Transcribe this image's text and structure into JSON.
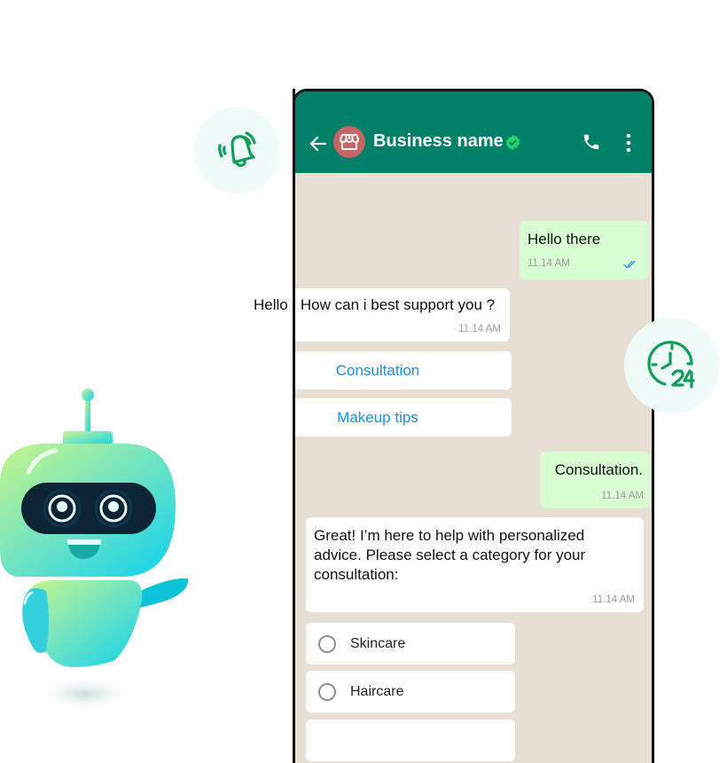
{
  "header": {
    "business_name": "Business name",
    "back_icon": "arrow-left-icon",
    "avatar_icon": "storefront-icon",
    "verified_icon": "verified-badge-icon",
    "call_icon": "phone-icon",
    "menu_icon": "more-vertical-icon"
  },
  "colors": {
    "header_bg": "#008069",
    "chat_bg": "#e8dfd4",
    "outgoing_bubble": "#d8fdd2",
    "incoming_bubble": "#ffffff",
    "link_blue": "#1a8fe3",
    "avatar_bg": "#c96464",
    "icon_green": "#0f9d58"
  },
  "messages": [
    {
      "direction": "outgoing",
      "text": "Hello there",
      "time": "11.14 AM",
      "status": "read"
    },
    {
      "direction": "incoming",
      "text": "Hello , How can i best support you ?",
      "time": "11.14 AM"
    },
    {
      "direction": "outgoing",
      "text": "Consultation.",
      "time": "11.14 AM"
    },
    {
      "direction": "incoming",
      "text": "Great! I’m here to help with personalized advice. Please select a category for your consultation:",
      "time": "11.14 AM"
    }
  ],
  "quick_replies": [
    {
      "label": "Consultation"
    },
    {
      "label": "Makeup tips"
    }
  ],
  "options": [
    {
      "label": "Skincare",
      "selected": false
    },
    {
      "label": "Haircare",
      "selected": false
    },
    {
      "label": "",
      "selected": false
    }
  ],
  "floating_badges": {
    "notification": "ringing-bell-icon",
    "availability": "clock-24-icon"
  },
  "mascot": "chatbot-robot-illustration"
}
